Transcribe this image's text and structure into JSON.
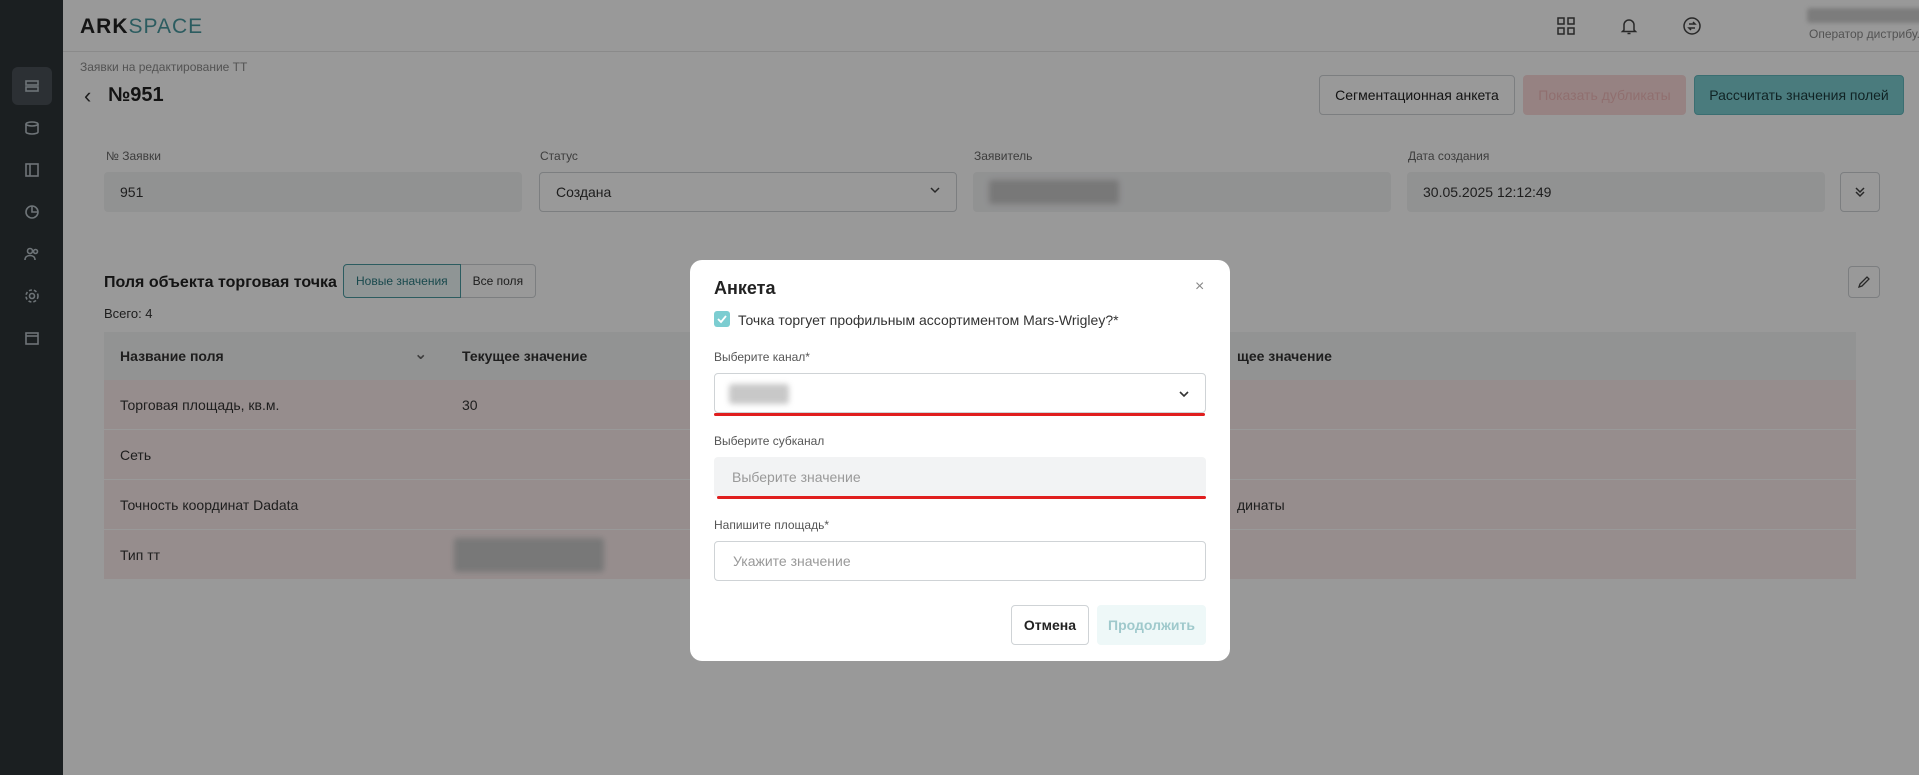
{
  "app": {
    "logo_ark": "ARK",
    "logo_space": "SPACE"
  },
  "user": {
    "role": "Оператор дистрибу..."
  },
  "sidebar": {
    "icons": [
      "list-icon",
      "database-icon",
      "table-icon",
      "chart-icon",
      "users-icon",
      "settings-icon",
      "calendar-icon"
    ]
  },
  "page": {
    "breadcrumb": "Заявки на редактирование ТТ",
    "title": "№951",
    "btn_segment": "Сегментационная анкета",
    "btn_duplicates": "Показать дубликаты",
    "btn_calc": "Рассчитать значения полей"
  },
  "info": {
    "num_label": "№ Заявки",
    "num_value": "951",
    "status_label": "Статус",
    "status_value": "Создана",
    "applicant_label": "Заявитель",
    "date_label": "Дата создания",
    "date_value": "30.05.2025 12:12:49"
  },
  "fields": {
    "title": "Поля объекта торговая точка",
    "toggle_new": "Новые значения",
    "toggle_all": "Все поля",
    "total": "Всего: 4",
    "columns": [
      "Название поля",
      "Текущее значение",
      "щее значение"
    ],
    "rows": [
      {
        "name": "Торговая площадь, кв.м.",
        "current": "30",
        "new": ""
      },
      {
        "name": "Сеть",
        "current": "",
        "new": ""
      },
      {
        "name": "Точность координат Dadata",
        "current": "",
        "new": "динаты"
      },
      {
        "name": "Тип тт",
        "current": "",
        "new": ""
      }
    ]
  },
  "modal": {
    "title": "Анкета",
    "checkbox_label": "Точка торгует профильным ассортиментом Mars-Wrigley?*",
    "channel_label": "Выберите канал*",
    "subchannel_label": "Выберите субканал",
    "subchannel_placeholder": "Выберите значение",
    "area_label": "Напишите площадь*",
    "area_placeholder": "Укажите значение",
    "cancel": "Отмена",
    "continue": "Продолжить"
  },
  "colors": {
    "accent": "#7ccdd1",
    "sidebar": "#2e3438",
    "highlight": "#e01e1e"
  }
}
